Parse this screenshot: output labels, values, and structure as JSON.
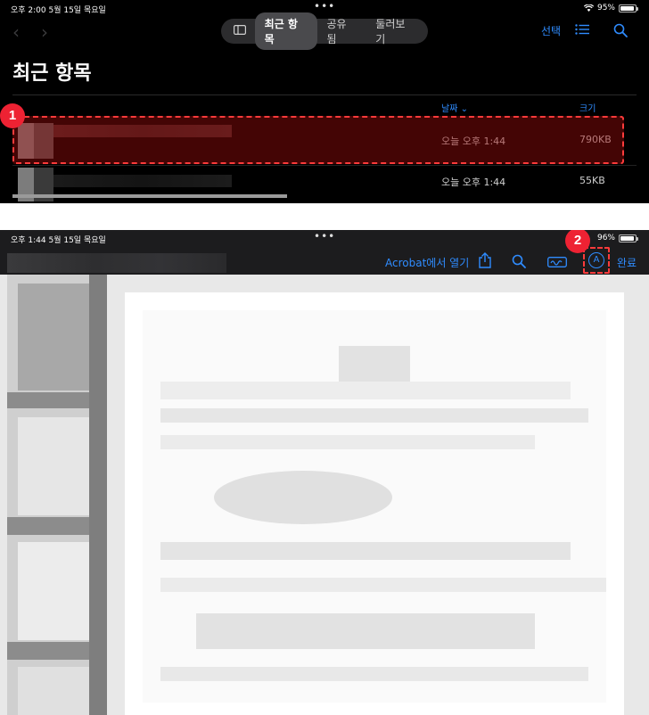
{
  "files_app": {
    "status_bar": {
      "time": "오후 2:00  5월 15일 목요일",
      "battery": "95%",
      "battery_level": 0.95
    },
    "segmented_control": {
      "tabs": [
        "최근 항목",
        "공유됨",
        "둘러보기"
      ],
      "active_index": 0
    },
    "toolbar": {
      "select_label": "선택"
    },
    "title": "최근 항목",
    "columns": {
      "date": "날짜",
      "size": "크기"
    },
    "rows": [
      {
        "date": "오늘 오후 1:44",
        "size": "790KB"
      },
      {
        "date": "오늘 오후 1:44",
        "size": "55KB"
      }
    ],
    "step_badge": "1"
  },
  "pdf_viewer": {
    "status_bar": {
      "time": "오후 1:44  5월 15일 목요일",
      "battery": "96%",
      "battery_level": 0.96
    },
    "toolbar": {
      "open_in_acrobat": "Acrobat에서 열기",
      "done": "완료"
    },
    "step_badge": "2"
  },
  "colors": {
    "accent": "#2f8cff",
    "highlight": "#ff3b3b",
    "badge": "#ee2233"
  },
  "icons": {
    "back": "chevron-left-icon",
    "forward": "chevron-right-icon",
    "sidebar": "sidebar-icon",
    "list": "list-icon",
    "search": "search-icon",
    "share": "share-icon",
    "signature": "signature-icon",
    "markup": "markup-pen-icon",
    "wifi": "wifi-icon"
  }
}
